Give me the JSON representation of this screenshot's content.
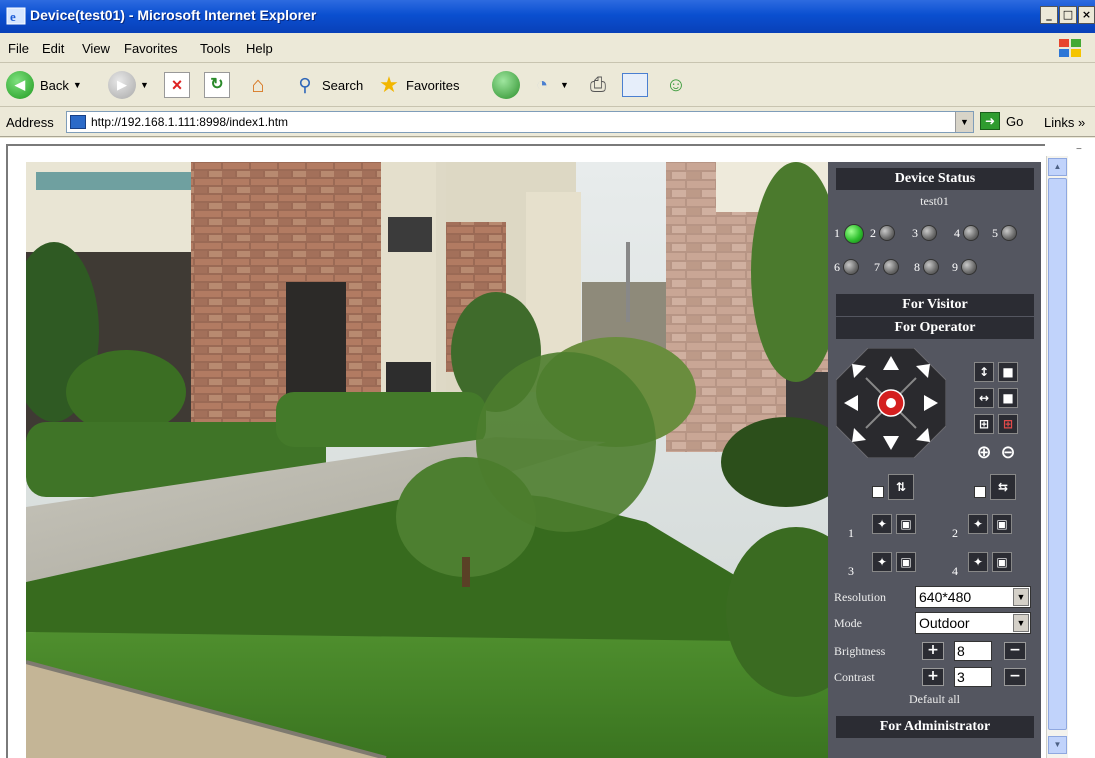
{
  "window": {
    "title": "Device(test01) - Microsoft Internet Explorer",
    "min": "_",
    "max": "□",
    "close": "×"
  },
  "menu": [
    "File",
    "Edit",
    "View",
    "Favorites",
    "Tools",
    "Help"
  ],
  "toolbar": {
    "back": "Back",
    "search": "Search",
    "favorites": "Favorites"
  },
  "address": {
    "label": "Address",
    "url": "http://192.168.1.111:8998/index1.htm",
    "go": "Go",
    "links": "Links »"
  },
  "panel": {
    "device_status": "Device Status",
    "device_name": "test01",
    "channels": [
      {
        "num": "1",
        "active": true
      },
      {
        "num": "2",
        "active": false
      },
      {
        "num": "3",
        "active": false
      },
      {
        "num": "4",
        "active": false
      },
      {
        "num": "5",
        "active": false
      },
      {
        "num": "6",
        "active": false
      },
      {
        "num": "7",
        "active": false
      },
      {
        "num": "8",
        "active": false
      },
      {
        "num": "9",
        "active": false
      }
    ],
    "for_visitor": "For Visitor",
    "for_operator": "For Operator",
    "preset_nums": [
      "1",
      "2",
      "3",
      "4"
    ],
    "resolution_label": "Resolution",
    "resolution_value": "640*480",
    "mode_label": "Mode",
    "mode_value": "Outdoor",
    "brightness_label": "Brightness",
    "brightness_value": "8",
    "contrast_label": "Contrast",
    "contrast_value": "3",
    "plus": "+",
    "minus": "−",
    "default_all": "Default all",
    "for_administrator": "For Administrator"
  },
  "colors": {
    "titlebar": "#0a4fd0",
    "panel_bg": "#545660",
    "section_header": "#2b2c33",
    "led_active": "#2ec02e"
  }
}
